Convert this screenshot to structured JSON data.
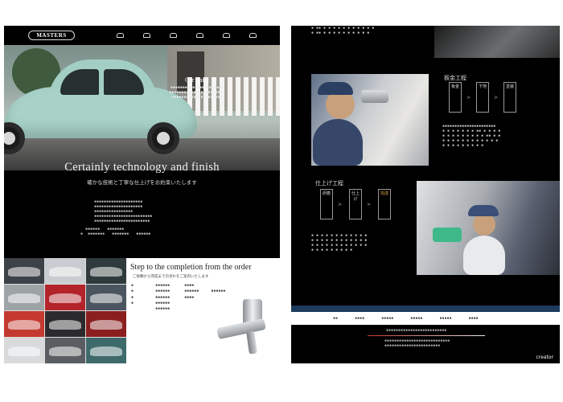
{
  "left_page": {
    "logo_text": "MASTERS",
    "nav": [
      {
        "label": "",
        "icon": "home-icon"
      },
      {
        "label": "",
        "icon": "car-icon"
      },
      {
        "label": "",
        "icon": "car-icon"
      },
      {
        "label": "",
        "icon": "car-icon"
      },
      {
        "label": "",
        "icon": "car-icon"
      },
      {
        "label": "",
        "icon": "car-icon"
      }
    ],
    "hero_caption_title": "Car Paint",
    "tagline": "Certainly technology and finish",
    "subtag": "確かな技術と丁寧な仕上げをお約束いたします",
    "step_title": "Step to the completion from the order",
    "step_sub": "ご依頼から完成までの流れをご案内いたします"
  },
  "right_page": {
    "section1_title": "板金工程",
    "section1_flow": [
      "板金",
      "下地",
      "塗装"
    ],
    "section2_title": "仕上げ工程",
    "section2_flow": [
      "研磨",
      "仕上げ",
      "完成"
    ],
    "brand": "creator"
  },
  "colors": {
    "background": "#000000",
    "accent_navy": "#1d3a5c",
    "accent_red": "#c0392b",
    "car": "#a8d2c8"
  }
}
